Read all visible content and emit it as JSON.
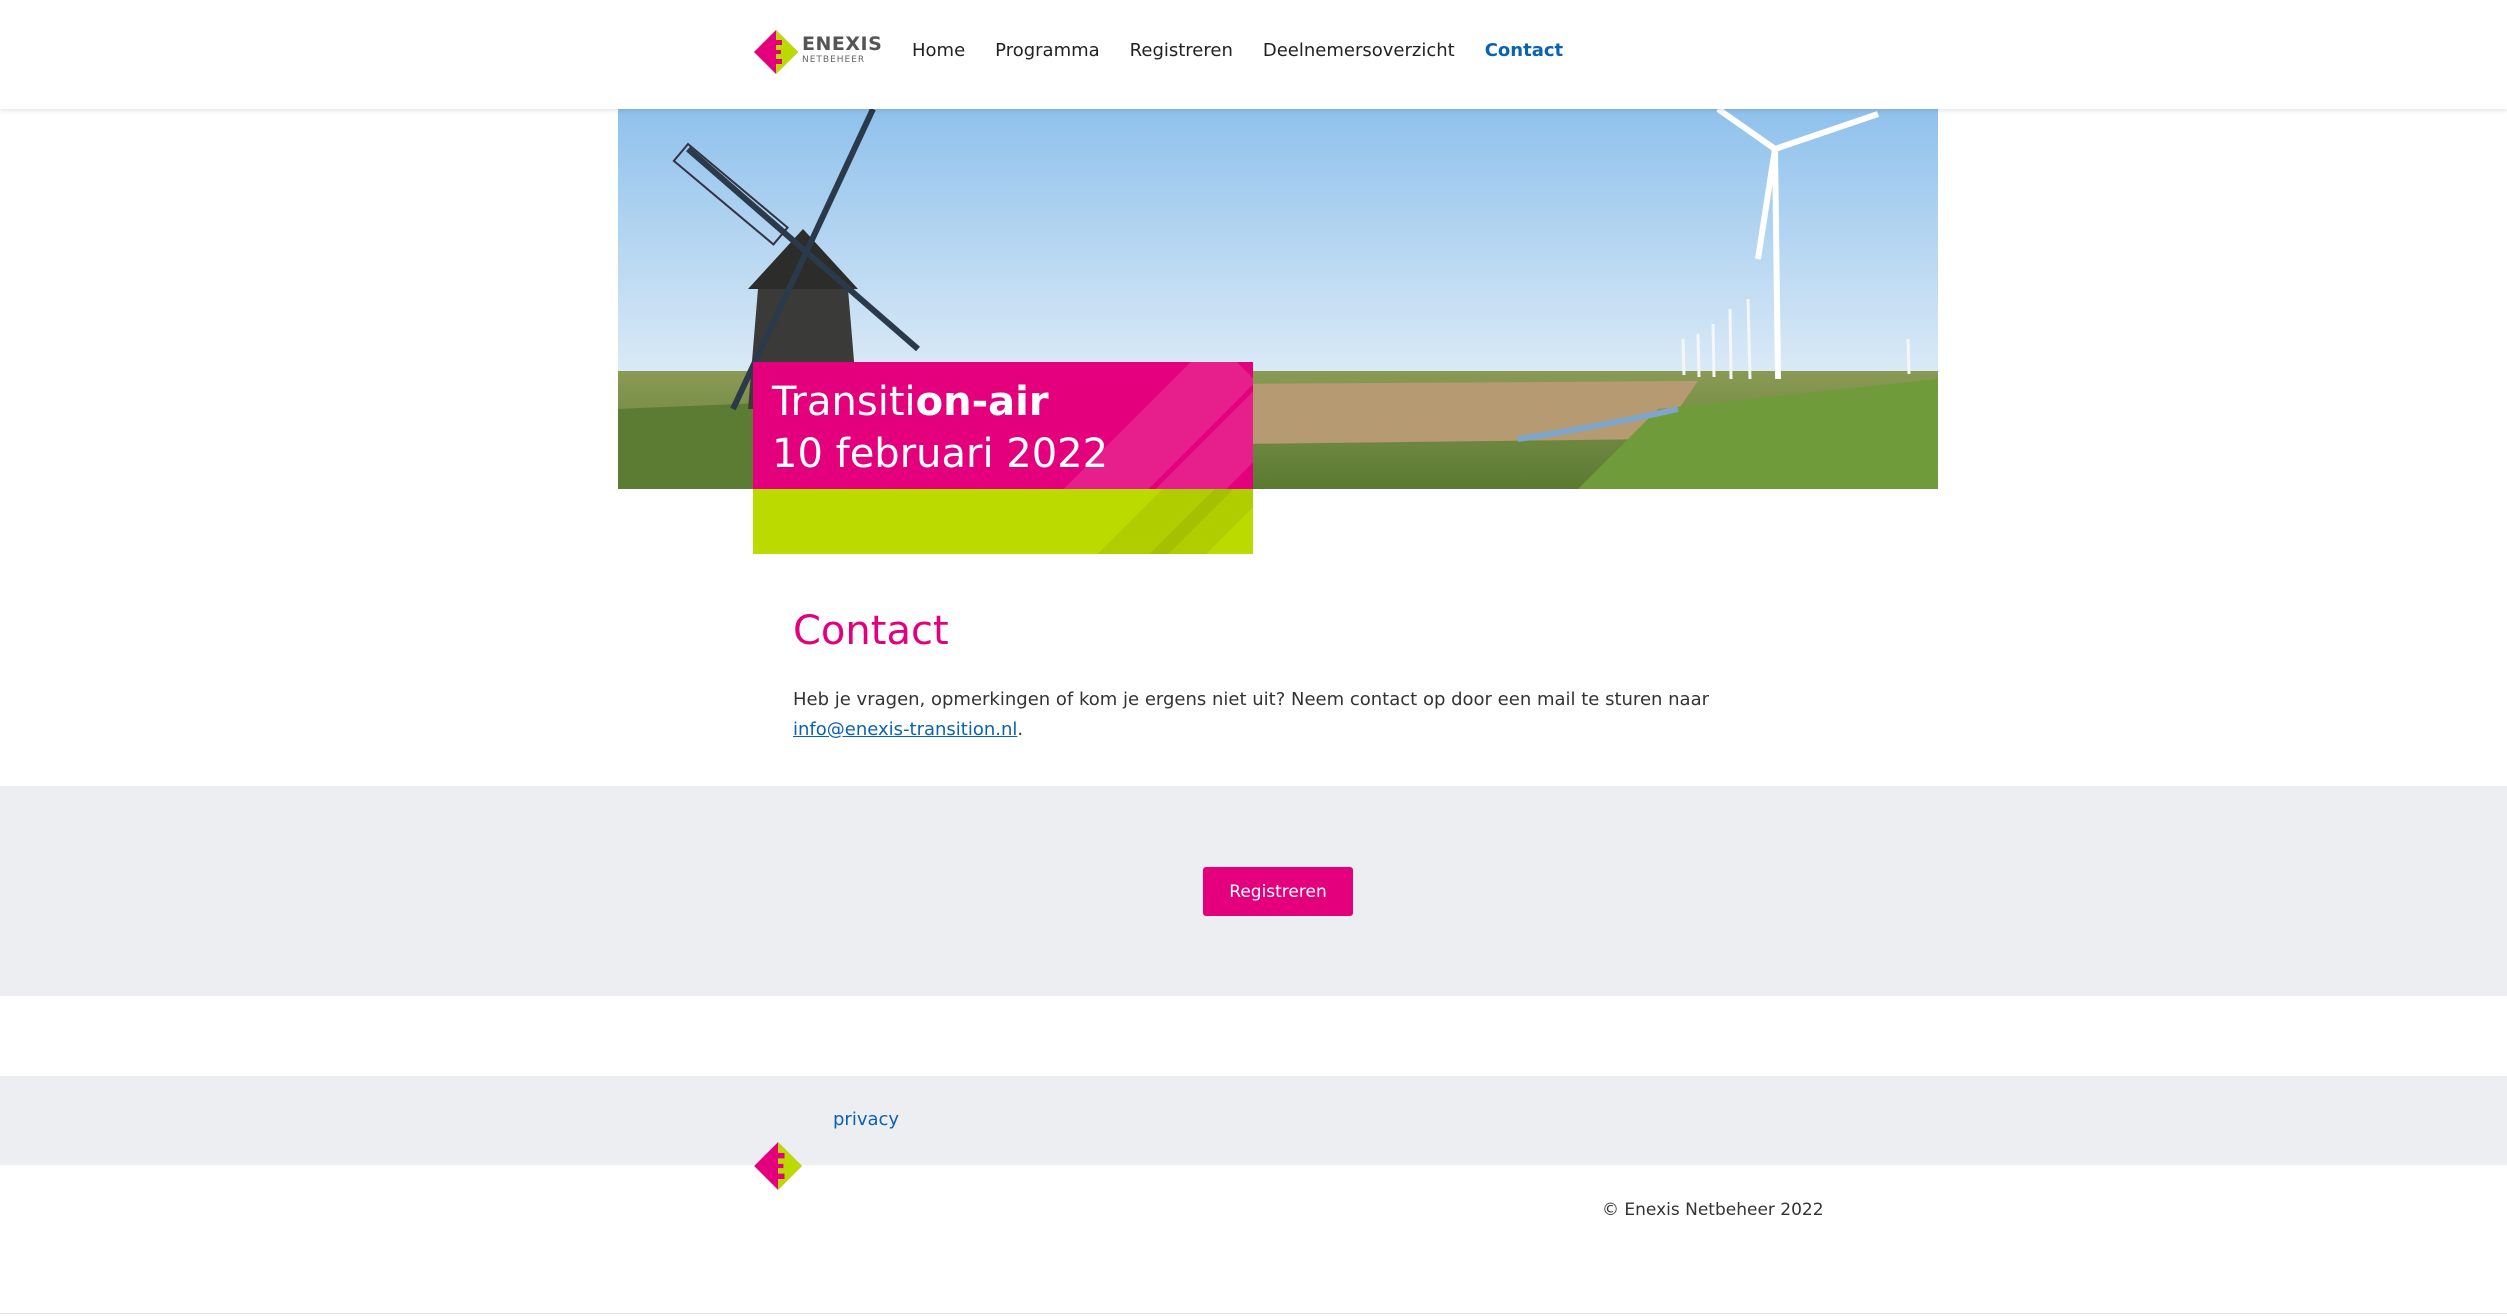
{
  "brand": {
    "logo_word": "ENEXIS",
    "logo_sub": "NETBEHEER",
    "pink": "#e4007d",
    "green": "#bbda00",
    "link_blue": "#0b62b1"
  },
  "nav": {
    "items": [
      {
        "label": "Home"
      },
      {
        "label": "Programma"
      },
      {
        "label": "Registreren"
      },
      {
        "label": "Deelnemersoverzicht"
      },
      {
        "label": "Contact",
        "active": true
      }
    ]
  },
  "hero": {
    "title_regular": "Transiti",
    "title_bold": "on-air",
    "date": "10 februari 2022"
  },
  "content": {
    "heading": "Contact",
    "text": "Heb je vragen, opmerkingen of kom je ergens niet uit? Neem contact op door een mail te sturen naar ",
    "email": "info@enexis-transition.nl",
    "after": "."
  },
  "register_button": "Registreren",
  "footer": {
    "privacy": "privacy",
    "copyright": "© Enexis Netbeheer 2022"
  }
}
